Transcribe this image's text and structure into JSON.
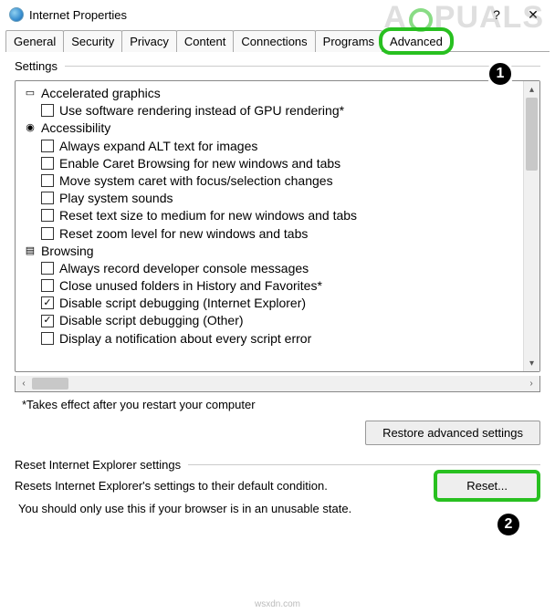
{
  "titlebar": {
    "title": "Internet Properties",
    "help": "?",
    "close": "✕"
  },
  "tabs": {
    "items": [
      {
        "label": "General"
      },
      {
        "label": "Security"
      },
      {
        "label": "Privacy"
      },
      {
        "label": "Content"
      },
      {
        "label": "Connections"
      },
      {
        "label": "Programs"
      },
      {
        "label": "Advanced"
      }
    ]
  },
  "settings": {
    "group_label": "Settings",
    "footnote": "*Takes effect after you restart your computer",
    "tree": [
      {
        "type": "cat",
        "icon": "monitor",
        "label": "Accelerated graphics"
      },
      {
        "type": "item",
        "checked": false,
        "label": "Use software rendering instead of GPU rendering*"
      },
      {
        "type": "cat",
        "icon": "globe",
        "label": "Accessibility"
      },
      {
        "type": "item",
        "checked": false,
        "label": "Always expand ALT text for images"
      },
      {
        "type": "item",
        "checked": false,
        "label": "Enable Caret Browsing for new windows and tabs"
      },
      {
        "type": "item",
        "checked": false,
        "label": "Move system caret with focus/selection changes"
      },
      {
        "type": "item",
        "checked": false,
        "label": "Play system sounds"
      },
      {
        "type": "item",
        "checked": false,
        "label": "Reset text size to medium for new windows and tabs"
      },
      {
        "type": "item",
        "checked": false,
        "label": "Reset zoom level for new windows and tabs"
      },
      {
        "type": "cat",
        "icon": "page",
        "label": "Browsing"
      },
      {
        "type": "item",
        "checked": false,
        "label": "Always record developer console messages"
      },
      {
        "type": "item",
        "checked": false,
        "label": "Close unused folders in History and Favorites*"
      },
      {
        "type": "item",
        "checked": true,
        "label": "Disable script debugging (Internet Explorer)"
      },
      {
        "type": "item",
        "checked": true,
        "label": "Disable script debugging (Other)"
      },
      {
        "type": "item",
        "checked": false,
        "label": "Display a notification about every script error"
      }
    ],
    "restore_button": "Restore advanced settings"
  },
  "reset": {
    "group_label": "Reset Internet Explorer settings",
    "description": "Resets Internet Explorer's settings to their default condition.",
    "button": "Reset...",
    "warning": "You should only use this if your browser is in an unusable state."
  },
  "annotations": {
    "one": "1",
    "two": "2"
  },
  "watermark": {
    "pre": "A",
    "post": "PUALS"
  },
  "footer": "wsxdn.com"
}
